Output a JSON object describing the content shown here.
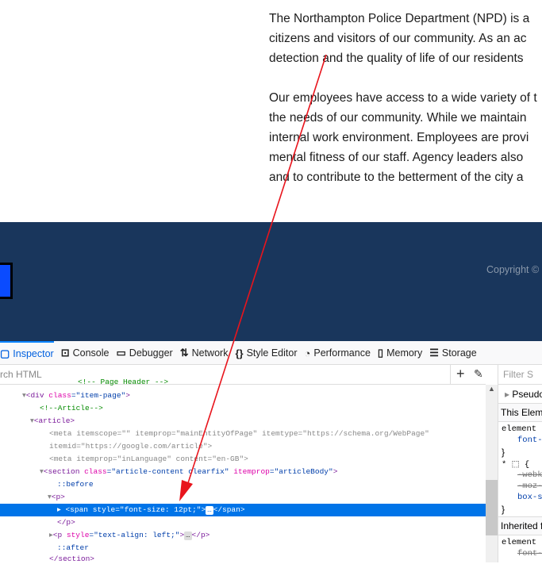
{
  "page": {
    "para1": [
      "The Northampton Police Department (NPD) is a",
      "citizens and visitors of our community.  As an ac",
      "detection and the quality of life of our residents"
    ],
    "para2": [
      "Our employees have access to a wide variety of t",
      "the needs of our community. While we maintain",
      "internal work environment. Employees are provi",
      "mental fitness of our staff.  Agency leaders also",
      "and to contribute to the betterment of the city a"
    ]
  },
  "footer": {
    "copyright": "Copyright ©"
  },
  "devtools": {
    "tabs": [
      "Inspector",
      "Console",
      "Debugger",
      "Network",
      "Style Editor",
      "Performance",
      "Memory",
      "Storage"
    ],
    "search_placeholder": "rch HTML",
    "filter_placeholder": "Filter S",
    "markup": {
      "l0": "<!-- Page Header -->",
      "l1a": "<div",
      "l1b": "class",
      "l1c": "\"item-page\"",
      "l1d": ">",
      "l2": "<!--Article-->",
      "l3": "<article>",
      "l4": "<meta itemscope=\"\" itemprop=\"mainEntityOfPage\" itemtype=\"https://schema.org/WebPage\"",
      "l5": "itemid=\"https://google.com/article\">",
      "l6": "<meta itemprop=\"inLanguage\" content=\"en-GB\">",
      "l7a": "<section",
      "l7b": "class",
      "l7c": "\"article-content clearfix\"",
      "l7d": "itemprop",
      "l7e": "\"articleBody\"",
      "l7f": ">",
      "l8": "::before",
      "l9": "<p>",
      "l10a": "<span style=\"font-size: 12pt;\">",
      "l10b": "…",
      "l10c": "</span>",
      "l11": "</p>",
      "l12a": "<p",
      "l12b": "style",
      "l12c": "\"text-align: left;\"",
      "l12d": ">",
      "l12e": "…",
      "l12f": "</p>",
      "l13": "::after",
      "l14": "</section>"
    },
    "rules": {
      "pseudo": "Pseudo",
      "this_element": "This Eleme",
      "element1": "element",
      "font1": "font-s",
      "brace": "}",
      "star": "* ⬚ {",
      "webkit": "-webk",
      "moz": "-moz-b",
      "box": "box-si",
      "inherited": "Inherited f",
      "element2": "element",
      "font2": "font-"
    }
  }
}
